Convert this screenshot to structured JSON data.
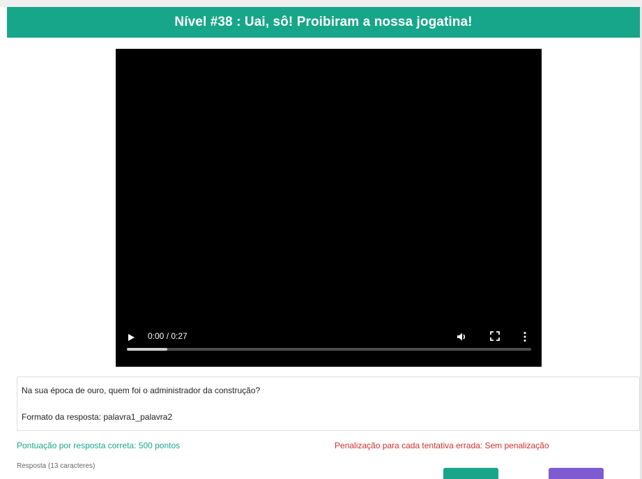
{
  "header": {
    "title": "Nível #38 : Uai, sô! Proibiram a nossa jogatina!"
  },
  "video": {
    "time_display": "0:00 / 0:27",
    "progress_fraction": 0.1,
    "icons": {
      "play": "play-icon",
      "volume": "volume-icon",
      "fullscreen": "fullscreen-icon",
      "menu": "more-vertical-icon"
    }
  },
  "question": {
    "text": "Na sua época de ouro, quem foi o administrador da construção?",
    "format": "Formato da resposta: palavra1_palavra2"
  },
  "scoring": {
    "points": "Pontuação por resposta correta: 500 pontos",
    "penalty": "Penalização para cada tentativa errada: Sem penalização"
  },
  "answer": {
    "label": "Resposta (13 caracteres)"
  },
  "colors": {
    "accent": "#17a689",
    "penalty": "#d32f2f",
    "secondary_button": "#7e5bd1"
  }
}
